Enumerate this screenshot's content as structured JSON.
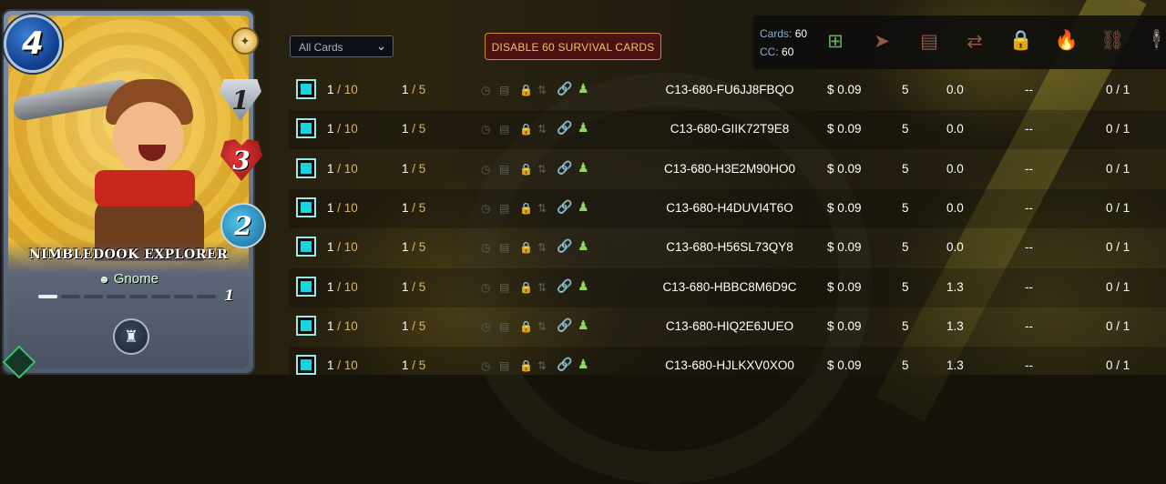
{
  "card": {
    "mana": "4",
    "armor": "1",
    "health": "3",
    "ranged": "2",
    "name": "NIMBLEDOOK EXPLORER",
    "type": "Gnome",
    "level": "1",
    "level_filled": 1,
    "level_total": 8,
    "icons": [
      "rarity-rare-icon",
      "gnome-icon",
      "edition-tower-icon",
      "foil-gem-icon"
    ],
    "colors": {
      "mana": "#1b58b8",
      "frame": "#6c7c90",
      "art_bg": "#e2b33a"
    }
  },
  "controls": {
    "filter_select": {
      "value": "All Cards"
    },
    "disable_button": "DISABLE 60 SURVIVAL CARDS"
  },
  "summary": {
    "cards_label": "Cards:",
    "cards_value": "60",
    "cc_label": "CC:",
    "cc_value": "60"
  },
  "toolbar": {
    "icons": [
      {
        "name": "add-to-collection-icon",
        "glyph": "⊞",
        "color": "#5fb35a"
      },
      {
        "name": "send-icon",
        "glyph": "➤",
        "color": "#8d5a4a"
      },
      {
        "name": "market-sell-icon",
        "glyph": "▤",
        "color": "#8d5a4a"
      },
      {
        "name": "transfer-icon",
        "glyph": "⇄",
        "color": "#8d5a4a"
      },
      {
        "name": "lock-icon",
        "glyph": "🔒",
        "color": "#5fb35a"
      },
      {
        "name": "burn-icon",
        "glyph": "🔥",
        "color": "#8d5a4a"
      },
      {
        "name": "unlink-icon",
        "glyph": "⛓",
        "color": "#8d5a4a"
      },
      {
        "name": "delegate-icon",
        "glyph": "🕴",
        "color": "#8d5a4a"
      }
    ]
  },
  "rows": [
    {
      "level": "1",
      "level_max": "/ 10",
      "bcx": "1",
      "bcx_max": "/ 5",
      "id": "C13-680-FU6JJ8FBQO",
      "price": "$ 0.09",
      "xp": "5",
      "power": "0.0",
      "rental": "--",
      "uses": "0 / 1"
    },
    {
      "level": "1",
      "level_max": "/ 10",
      "bcx": "1",
      "bcx_max": "/ 5",
      "id": "C13-680-GIIK72T9E8",
      "price": "$ 0.09",
      "xp": "5",
      "power": "0.0",
      "rental": "--",
      "uses": "0 / 1"
    },
    {
      "level": "1",
      "level_max": "/ 10",
      "bcx": "1",
      "bcx_max": "/ 5",
      "id": "C13-680-H3E2M90HO0",
      "price": "$ 0.09",
      "xp": "5",
      "power": "0.0",
      "rental": "--",
      "uses": "0 / 1"
    },
    {
      "level": "1",
      "level_max": "/ 10",
      "bcx": "1",
      "bcx_max": "/ 5",
      "id": "C13-680-H4DUVI4T6O",
      "price": "$ 0.09",
      "xp": "5",
      "power": "0.0",
      "rental": "--",
      "uses": "0 / 1"
    },
    {
      "level": "1",
      "level_max": "/ 10",
      "bcx": "1",
      "bcx_max": "/ 5",
      "id": "C13-680-H56SL73QY8",
      "price": "$ 0.09",
      "xp": "5",
      "power": "0.0",
      "rental": "--",
      "uses": "0 / 1"
    },
    {
      "level": "1",
      "level_max": "/ 10",
      "bcx": "1",
      "bcx_max": "/ 5",
      "id": "C13-680-HBBC8M6D9C",
      "price": "$ 0.09",
      "xp": "5",
      "power": "1.3",
      "rental": "--",
      "uses": "0 / 1"
    },
    {
      "level": "1",
      "level_max": "/ 10",
      "bcx": "1",
      "bcx_max": "/ 5",
      "id": "C13-680-HIQ2E6JUEO",
      "price": "$ 0.09",
      "xp": "5",
      "power": "1.3",
      "rental": "--",
      "uses": "0 / 1"
    },
    {
      "level": "1",
      "level_max": "/ 10",
      "bcx": "1",
      "bcx_max": "/ 5",
      "id": "C13-680-HJLKXV0XO0",
      "price": "$ 0.09",
      "xp": "5",
      "power": "1.3",
      "rental": "--",
      "uses": "0 / 1"
    }
  ],
  "row_icons": {
    "status": [
      {
        "name": "clock-icon",
        "glyph": "◷"
      },
      {
        "name": "market-icon",
        "glyph": "▤"
      },
      {
        "name": "lock-icon",
        "glyph": "🔒"
      },
      {
        "name": "transfer-icon",
        "glyph": "⇅"
      }
    ],
    "link": {
      "name": "link-icon",
      "glyph": "🔗"
    },
    "owner": {
      "name": "owner-icon",
      "glyph": "♟"
    }
  }
}
